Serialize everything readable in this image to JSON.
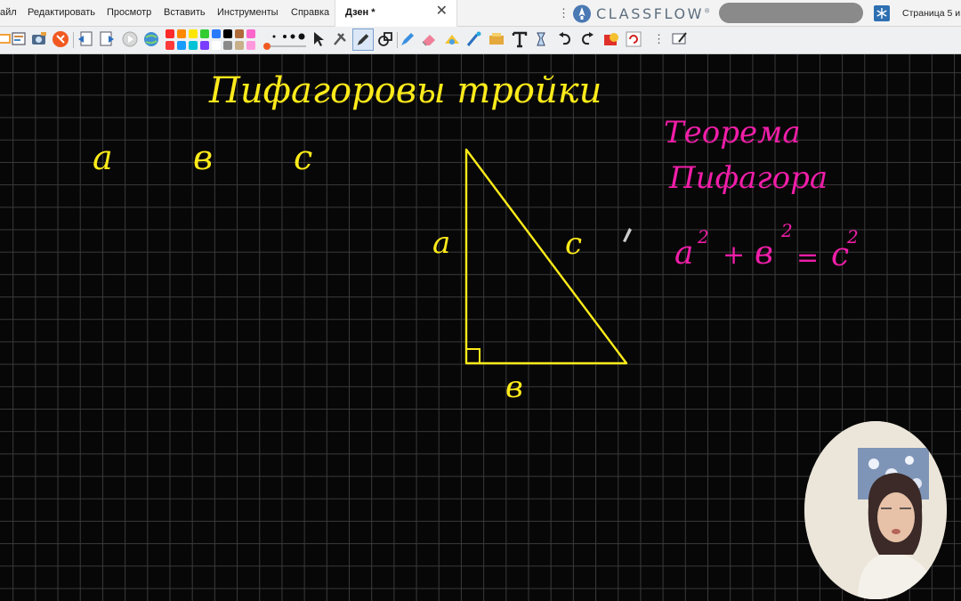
{
  "menu": {
    "items": [
      "айл",
      "Редактировать",
      "Просмотр",
      "Вставить",
      "Инструменты",
      "Справка"
    ],
    "tab_label": "Дзен *",
    "tab_close": "✕"
  },
  "brand": {
    "name": "CLASSFLOW",
    "mark": "®"
  },
  "page_indicator": "Страница 5 и",
  "toolbar": {
    "palette": [
      "#ff2a2a",
      "#ff8a00",
      "#ffe600",
      "#33cc33",
      "#2a7bff",
      "#000000",
      "#b06a3a",
      "#ff66cc",
      "#ff3a3a",
      "#1a9bff",
      "#00c2d6",
      "#7a3dff",
      "#ffffff",
      "#8a8a8a",
      "#c8b08a",
      "#ff99dd"
    ],
    "icons": [
      "slideshow-icon",
      "flipchart-icon",
      "camera-icon",
      "stop-icon",
      "prev-page-icon",
      "next-page-icon",
      "record-icon",
      "globe-icon",
      "pen-width-icon",
      "select-icon",
      "fill-icon",
      "pen-icon",
      "shapes-icon",
      "highlighter-icon",
      "eraser-icon",
      "spotlight-icon",
      "magic-ink-icon",
      "clear-icon",
      "text-icon",
      "connector-icon",
      "undo-icon",
      "redo-icon",
      "reset-icon",
      "refresh-icon",
      "more-icon",
      "desktop-annotate-icon"
    ]
  },
  "board": {
    "title": "Пифагоровы тройки",
    "col_a": "a",
    "col_b": "в",
    "col_c": "c",
    "side_a": "a",
    "side_b": "в",
    "side_c": "c",
    "theorem_line1": "Теорема",
    "theorem_line2": "Пифагора",
    "formula": {
      "a": "a",
      "b": "в",
      "c": "c",
      "exp": "2",
      "plus": "+",
      "equals": "="
    },
    "colors": {
      "yellow": "#ffeb1a",
      "pink": "#f01ea8",
      "grid": "#3a3a3a"
    }
  }
}
